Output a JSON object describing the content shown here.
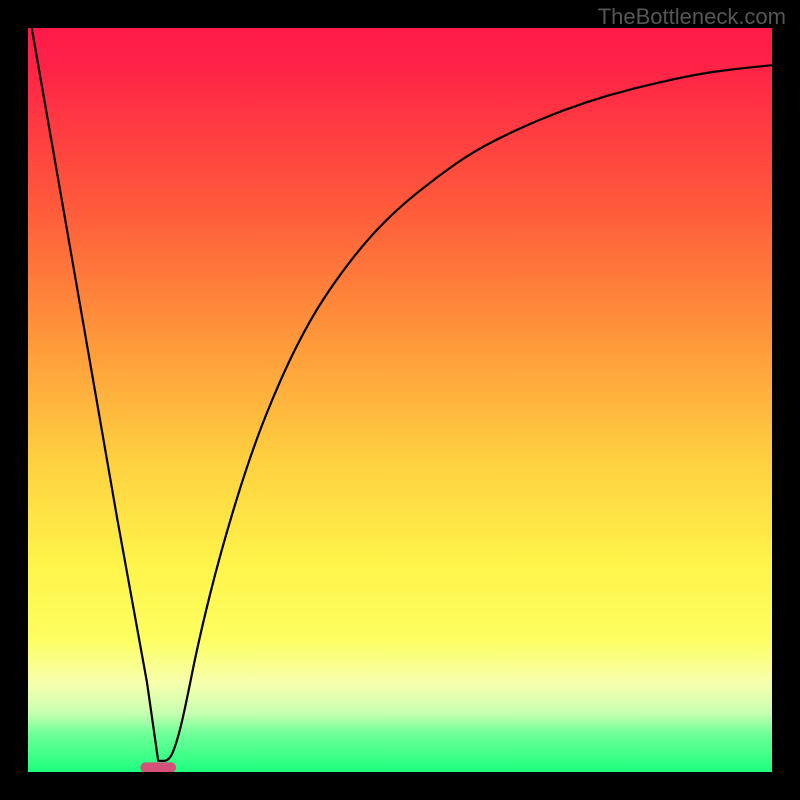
{
  "watermark": "TheBottleneck.com",
  "chart_data": {
    "type": "line",
    "title": "",
    "xlabel": "",
    "ylabel": "",
    "xlim": [
      0,
      100
    ],
    "ylim": [
      0,
      100
    ],
    "grid": false,
    "legend": false,
    "series": [
      {
        "name": "v-curve",
        "x": [
          0.5,
          4,
          8,
          12,
          16,
          17.5,
          19,
          20,
          21,
          23,
          26,
          30,
          34,
          38,
          42,
          46,
          50,
          55,
          60,
          66,
          72,
          78,
          84,
          90,
          95,
          100
        ],
        "y": [
          100,
          80,
          57,
          34,
          12,
          1.5,
          1.5,
          4,
          8,
          18,
          30,
          43,
          53,
          61,
          67,
          72,
          76,
          80,
          83.5,
          86.5,
          89,
          91,
          92.5,
          93.8,
          94.5,
          95
        ]
      }
    ],
    "marker": {
      "x_center": 17.5,
      "y": 0.6,
      "width": 4.8,
      "height": 1.4,
      "color": "#d6517a"
    },
    "colors": {
      "line": "#000000",
      "gradient_top": "#ff1a4a",
      "gradient_bottom": "#1dff7e"
    }
  }
}
